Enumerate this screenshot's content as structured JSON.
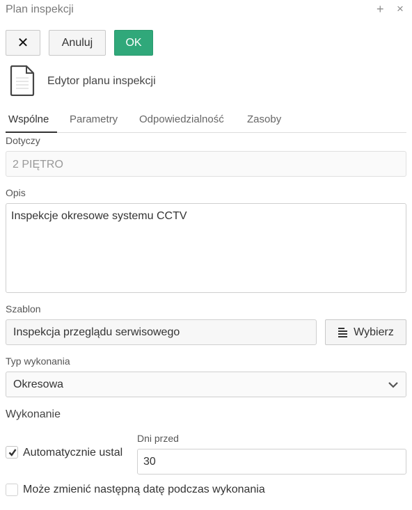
{
  "window": {
    "title": "Plan inspekcji",
    "add_glyph": "+",
    "close_glyph": "×"
  },
  "toolbar": {
    "close_glyph": "✕",
    "cancel_label": "Anuluj",
    "ok_label": "OK"
  },
  "editor": {
    "icon": "document-icon",
    "title": "Edytor planu inspekcji"
  },
  "tabs": [
    {
      "label": "Wspólne",
      "active": true
    },
    {
      "label": "Parametry"
    },
    {
      "label": "Odpowiedzialność"
    },
    {
      "label": "Zasoby"
    }
  ],
  "form": {
    "dotyczy": {
      "label": "Dotyczy",
      "value": "2 PIĘTRO"
    },
    "opis": {
      "label": "Opis",
      "value": "Inspekcje okresowe systemu CCTV"
    },
    "szablon": {
      "label": "Szablon",
      "value": "Inspekcja przeglądu serwisowego",
      "button_label": "Wybierz",
      "button_icon": "list-icon"
    },
    "typ_wykonania": {
      "label": "Typ wykonania",
      "value": "Okresowa"
    },
    "wykonanie": {
      "title": "Wykonanie",
      "auto_label": "Automatycznie ustal",
      "auto_checked": true,
      "dni_przed_label": "Dni przed",
      "dni_przed_value": "30",
      "change_label": "Może zmienić następną datę podczas wykonania",
      "change_checked": false
    }
  },
  "colors": {
    "ok_button": "#30a87a",
    "active_tab": "#333333"
  }
}
